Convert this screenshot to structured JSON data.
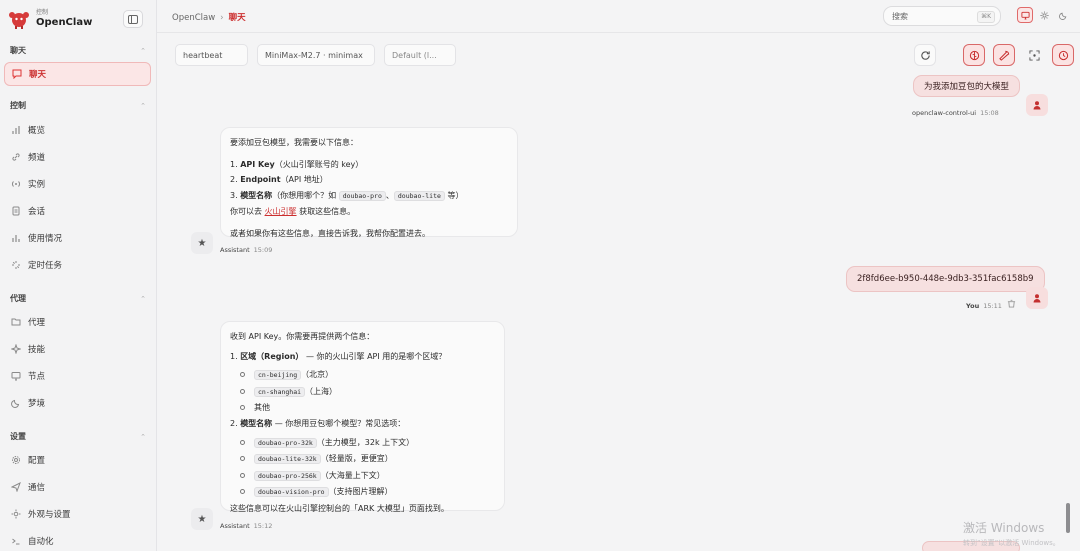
{
  "brand": {
    "sub": "控制",
    "name": "OpenClaw"
  },
  "sidebar": {
    "sections": [
      {
        "title": "聊天",
        "items": [
          {
            "label": "聊天"
          }
        ]
      },
      {
        "title": "控制",
        "items": [
          {
            "label": "概览"
          },
          {
            "label": "频道"
          },
          {
            "label": "实例"
          },
          {
            "label": "会话"
          },
          {
            "label": "使用情况"
          },
          {
            "label": "定时任务"
          }
        ]
      },
      {
        "title": "代理",
        "items": [
          {
            "label": "代理"
          },
          {
            "label": "技能"
          },
          {
            "label": "节点"
          },
          {
            "label": "梦境"
          }
        ]
      },
      {
        "title": "设置",
        "items": [
          {
            "label": "配置"
          },
          {
            "label": "通信"
          },
          {
            "label": "外观与设置"
          },
          {
            "label": "自动化"
          }
        ]
      }
    ]
  },
  "header": {
    "breadcrumb_root": "OpenClaw",
    "breadcrumb_current": "聊天",
    "search_placeholder": "搜索",
    "search_shortcut": "⌘K"
  },
  "toolbar": {
    "session": "heartbeat",
    "model": "MiniMax-M2.7 · minimax",
    "profile": "Default (l..."
  },
  "messages": {
    "m1": {
      "text": "为我添加豆包的大模型",
      "sender": "openclaw-control-ui",
      "time": "15:08"
    },
    "m2": {
      "intro": "要添加豆包模型，我需要以下信息：",
      "i1_num": "1.",
      "i1_bold": "API Key",
      "i1_rest": "（火山引擎账号的 key）",
      "i2_num": "2.",
      "i2_bold": "Endpoint",
      "i2_rest": "（API 地址）",
      "i3_num": "3.",
      "i3_bold": "模型名称",
      "i3_rest": "（你想用哪个？如",
      "i3_code1": "doubao-pro",
      "i3_sep": "、",
      "i3_code2": "doubao-lite",
      "i3_tail": "等）",
      "line_pre": "你可以去",
      "line_link": "火山引擎",
      "line_post": "获取这些信息。",
      "outro": "或者如果你有这些信息，直接告诉我，我帮你配置进去。",
      "sender": "Assistant",
      "time": "15:09"
    },
    "m3": {
      "text": "2f8fd6ee-b950-448e-9db3-351fac6158b9",
      "sender": "You",
      "time": "15:11"
    },
    "m4": {
      "intro": "收到 API Key。你需要再提供两个信息：",
      "q1_num": "1.",
      "q1_bold": "区域（Region）",
      "q1_rest": "— 你的火山引擎 API 用的是哪个区域？",
      "r1_code": "cn-beijing",
      "r1_rest": "（北京）",
      "r2_code": "cn-shanghai",
      "r2_rest": "（上海）",
      "r3": "其他",
      "q2_num": "2.",
      "q2_bold": "模型名称",
      "q2_rest": "— 你想用豆包哪个模型？常见选项：",
      "o1_code": "doubao-pro-32k",
      "o1_rest": "（主力模型，32k 上下文）",
      "o2_code": "doubao-lite-32k",
      "o2_rest": "（轻量版，更便宜）",
      "o3_code": "doubao-pro-256k",
      "o3_rest": "（大海量上下文）",
      "o4_code": "doubao-vision-pro",
      "o4_rest": "（支持图片理解）",
      "outro": "这些信息可以在火山引擎控制台的「ARK 大模型」页面找到。",
      "sender": "Assistant",
      "time": "15:12"
    }
  },
  "watermark": {
    "line1": "激活 Windows",
    "line2": "转到“设置”以激活 Windows。"
  },
  "colors": {
    "accent": "#cc2f2f",
    "accent_bg": "#fbe6e6"
  }
}
